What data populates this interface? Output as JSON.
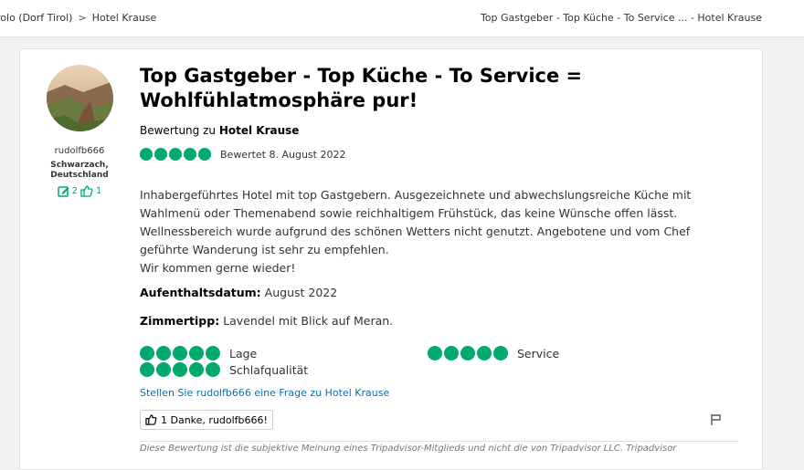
{
  "breadcrumb": {
    "items": [
      "rolo (Dorf Tirol)",
      "Hotel Krause"
    ],
    "separator": ">",
    "current_title": "Top Gastgeber - Top Küche - To Service ... - Hotel Krause"
  },
  "reviewer": {
    "username": "rudolfb666",
    "location_line1": "Schwarzach,",
    "location_line2": "Deutschland",
    "contributions": "2",
    "helpful_votes": "1"
  },
  "review": {
    "title": "Top Gastgeber - Top Küche - To Service = Wohlfühlatmosphäre pur!",
    "about_prefix": "Bewertung zu",
    "hotel_name": "Hotel Krause",
    "rating": 5,
    "rating_max": 5,
    "date": "Bewertet 8. August 2022",
    "body_lines": [
      "Inhabergeführtes Hotel mit top Gastgebern. Ausgezeichnete und abwechslungsreiche Küche mit",
      "Wahlmenü oder Themenabend sowie reichhaltigem Frühstück, das keine Wünsche offen lässt.",
      "Wellnessbereich wurde aufgrund des schönen Wetters nicht genutzt. Angebotene und vom Chef",
      "geführte Wanderung ist sehr zu empfehlen.",
      "Wir kommen gerne wieder!"
    ],
    "stay_label": "Aufenthaltsdatum:",
    "stay_value": "August 2022",
    "tip_label": "Zimmertipp:",
    "tip_value": "Lavendel mit Blick auf Meran.",
    "subratings": [
      {
        "label": "Lage",
        "rating": 5
      },
      {
        "label": "Service",
        "rating": 5
      },
      {
        "label": "Schlafqualität",
        "rating": 5
      }
    ],
    "ask_link": "Stellen Sie rudolfb666 eine Frage zu Hotel Krause",
    "thanks_label": "1 Danke, rudolfb666!",
    "disclaimer": "Diese Bewertung ist die subjektive Meinung eines Tripadvisor-Mitglieds und nicht die von Tripadvisor LLC. Tripadvisor"
  },
  "colors": {
    "accent_green": "#00aa6c",
    "link_blue": "#0b6fa8"
  },
  "icons": {
    "contributions": "edit-icon",
    "helpful": "thumbs-up-icon",
    "thanks": "thumbs-up-icon",
    "report": "flag-icon"
  }
}
